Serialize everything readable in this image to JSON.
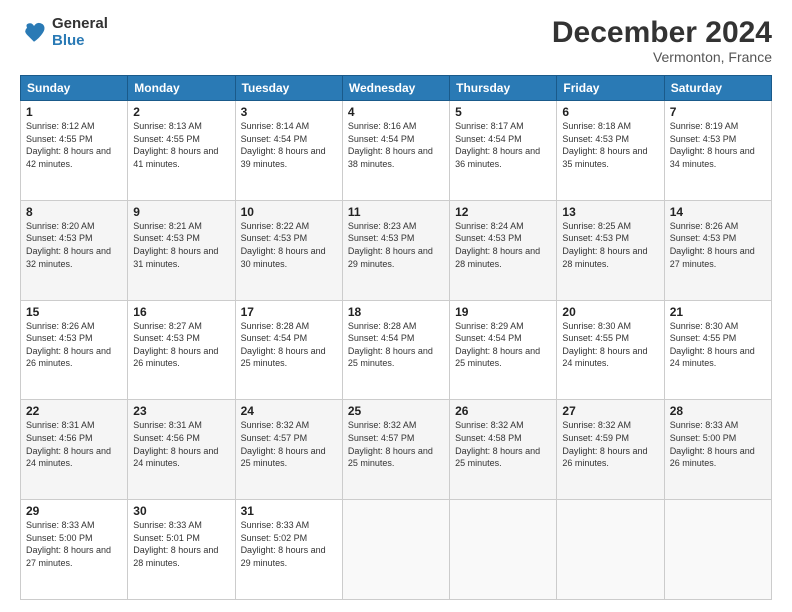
{
  "logo": {
    "general": "General",
    "blue": "Blue"
  },
  "title": "December 2024",
  "location": "Vermonton, France",
  "days_header": [
    "Sunday",
    "Monday",
    "Tuesday",
    "Wednesday",
    "Thursday",
    "Friday",
    "Saturday"
  ],
  "weeks": [
    [
      {
        "day": "1",
        "sunrise": "8:12 AM",
        "sunset": "4:55 PM",
        "daylight": "8 hours and 42 minutes."
      },
      {
        "day": "2",
        "sunrise": "8:13 AM",
        "sunset": "4:55 PM",
        "daylight": "8 hours and 41 minutes."
      },
      {
        "day": "3",
        "sunrise": "8:14 AM",
        "sunset": "4:54 PM",
        "daylight": "8 hours and 39 minutes."
      },
      {
        "day": "4",
        "sunrise": "8:16 AM",
        "sunset": "4:54 PM",
        "daylight": "8 hours and 38 minutes."
      },
      {
        "day": "5",
        "sunrise": "8:17 AM",
        "sunset": "4:54 PM",
        "daylight": "8 hours and 36 minutes."
      },
      {
        "day": "6",
        "sunrise": "8:18 AM",
        "sunset": "4:53 PM",
        "daylight": "8 hours and 35 minutes."
      },
      {
        "day": "7",
        "sunrise": "8:19 AM",
        "sunset": "4:53 PM",
        "daylight": "8 hours and 34 minutes."
      }
    ],
    [
      {
        "day": "8",
        "sunrise": "8:20 AM",
        "sunset": "4:53 PM",
        "daylight": "8 hours and 32 minutes."
      },
      {
        "day": "9",
        "sunrise": "8:21 AM",
        "sunset": "4:53 PM",
        "daylight": "8 hours and 31 minutes."
      },
      {
        "day": "10",
        "sunrise": "8:22 AM",
        "sunset": "4:53 PM",
        "daylight": "8 hours and 30 minutes."
      },
      {
        "day": "11",
        "sunrise": "8:23 AM",
        "sunset": "4:53 PM",
        "daylight": "8 hours and 29 minutes."
      },
      {
        "day": "12",
        "sunrise": "8:24 AM",
        "sunset": "4:53 PM",
        "daylight": "8 hours and 28 minutes."
      },
      {
        "day": "13",
        "sunrise": "8:25 AM",
        "sunset": "4:53 PM",
        "daylight": "8 hours and 28 minutes."
      },
      {
        "day": "14",
        "sunrise": "8:26 AM",
        "sunset": "4:53 PM",
        "daylight": "8 hours and 27 minutes."
      }
    ],
    [
      {
        "day": "15",
        "sunrise": "8:26 AM",
        "sunset": "4:53 PM",
        "daylight": "8 hours and 26 minutes."
      },
      {
        "day": "16",
        "sunrise": "8:27 AM",
        "sunset": "4:53 PM",
        "daylight": "8 hours and 26 minutes."
      },
      {
        "day": "17",
        "sunrise": "8:28 AM",
        "sunset": "4:54 PM",
        "daylight": "8 hours and 25 minutes."
      },
      {
        "day": "18",
        "sunrise": "8:28 AM",
        "sunset": "4:54 PM",
        "daylight": "8 hours and 25 minutes."
      },
      {
        "day": "19",
        "sunrise": "8:29 AM",
        "sunset": "4:54 PM",
        "daylight": "8 hours and 25 minutes."
      },
      {
        "day": "20",
        "sunrise": "8:30 AM",
        "sunset": "4:55 PM",
        "daylight": "8 hours and 24 minutes."
      },
      {
        "day": "21",
        "sunrise": "8:30 AM",
        "sunset": "4:55 PM",
        "daylight": "8 hours and 24 minutes."
      }
    ],
    [
      {
        "day": "22",
        "sunrise": "8:31 AM",
        "sunset": "4:56 PM",
        "daylight": "8 hours and 24 minutes."
      },
      {
        "day": "23",
        "sunrise": "8:31 AM",
        "sunset": "4:56 PM",
        "daylight": "8 hours and 24 minutes."
      },
      {
        "day": "24",
        "sunrise": "8:32 AM",
        "sunset": "4:57 PM",
        "daylight": "8 hours and 25 minutes."
      },
      {
        "day": "25",
        "sunrise": "8:32 AM",
        "sunset": "4:57 PM",
        "daylight": "8 hours and 25 minutes."
      },
      {
        "day": "26",
        "sunrise": "8:32 AM",
        "sunset": "4:58 PM",
        "daylight": "8 hours and 25 minutes."
      },
      {
        "day": "27",
        "sunrise": "8:32 AM",
        "sunset": "4:59 PM",
        "daylight": "8 hours and 26 minutes."
      },
      {
        "day": "28",
        "sunrise": "8:33 AM",
        "sunset": "5:00 PM",
        "daylight": "8 hours and 26 minutes."
      }
    ],
    [
      {
        "day": "29",
        "sunrise": "8:33 AM",
        "sunset": "5:00 PM",
        "daylight": "8 hours and 27 minutes."
      },
      {
        "day": "30",
        "sunrise": "8:33 AM",
        "sunset": "5:01 PM",
        "daylight": "8 hours and 28 minutes."
      },
      {
        "day": "31",
        "sunrise": "8:33 AM",
        "sunset": "5:02 PM",
        "daylight": "8 hours and 29 minutes."
      },
      null,
      null,
      null,
      null
    ]
  ],
  "labels": {
    "sunrise": "Sunrise:",
    "sunset": "Sunset:",
    "daylight": "Daylight:"
  }
}
